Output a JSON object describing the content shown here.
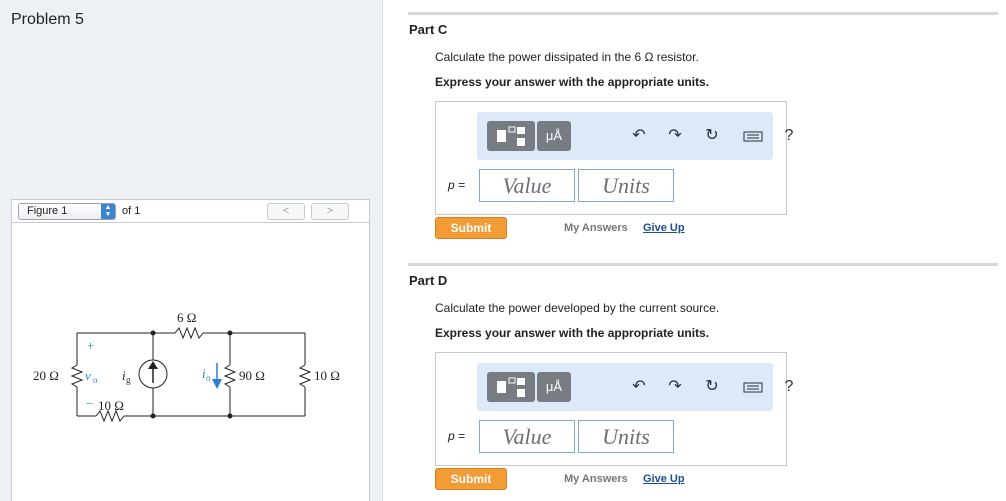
{
  "problem": {
    "title": "Problem 5"
  },
  "figure": {
    "select_label": "Figure 1",
    "of_text": "of 1",
    "prev": "<",
    "next": ">",
    "circuit_labels": {
      "r20": "20 Ω",
      "r6": "6 Ω",
      "r90": "90 Ω",
      "r10_right": "10 Ω",
      "r10_bottom": "10 Ω",
      "vo": "v",
      "vo_sub": "o",
      "ig": "i",
      "ig_sub": "g",
      "io": "i",
      "io_sub": "o",
      "plus": "+",
      "minus": "−"
    }
  },
  "parts": [
    {
      "title": "Part C",
      "question": "Calculate the power dissipated in the 6 Ω resistor.",
      "instruction": "Express your answer with the appropriate units.",
      "answer_label": "p =",
      "value_placeholder": "Value",
      "units_placeholder": "Units",
      "submit": "Submit",
      "my_answers": "My Answers",
      "give_up": "Give Up"
    },
    {
      "title": "Part D",
      "question": "Calculate the power developed by the current source.",
      "instruction": "Express your answer with the appropriate units.",
      "answer_label": "p =",
      "value_placeholder": "Value",
      "units_placeholder": "Units",
      "submit": "Submit",
      "my_answers": "My Answers",
      "give_up": "Give Up"
    }
  ],
  "toolbar": {
    "mu_label": "μÅ",
    "help": "?",
    "icons": [
      "template-icon",
      "undo-icon",
      "redo-icon",
      "reset-icon",
      "keyboard-icon",
      "help-icon"
    ]
  },
  "colors": {
    "submit": "#f39b35",
    "toolbar_bg": "#dbe9f9",
    "link": "#1b4f8f"
  }
}
